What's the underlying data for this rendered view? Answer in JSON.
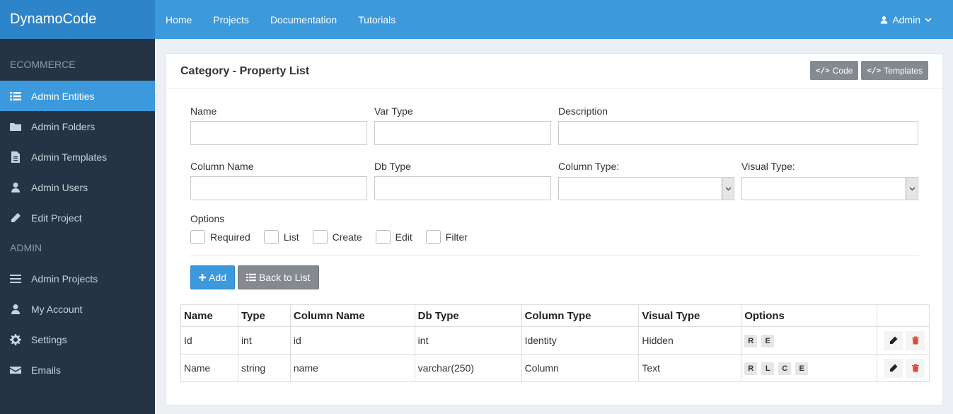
{
  "brand": "DynamoCode",
  "sidebar": {
    "section1": "ECOMMERCE",
    "items1": [
      {
        "label": "Admin Entities"
      },
      {
        "label": "Admin Folders"
      },
      {
        "label": "Admin Templates"
      },
      {
        "label": "Admin Users"
      },
      {
        "label": "Edit Project"
      }
    ],
    "section2": "ADMIN",
    "items2": [
      {
        "label": "Admin Projects"
      },
      {
        "label": "My Account"
      },
      {
        "label": "Settings"
      },
      {
        "label": "Emails"
      }
    ]
  },
  "topnav": {
    "links": [
      "Home",
      "Projects",
      "Documentation",
      "Tutorials"
    ],
    "user": "Admin"
  },
  "panel": {
    "title": "Category - Property List",
    "code_btn": "Code",
    "templates_btn": "Templates"
  },
  "form": {
    "name_label": "Name",
    "vartype_label": "Var Type",
    "description_label": "Description",
    "columnname_label": "Column Name",
    "dbtype_label": "Db Type",
    "columntype_label": "Column Type:",
    "visualtype_label": "Visual Type:",
    "options_label": "Options",
    "options": [
      "Required",
      "List",
      "Create",
      "Edit",
      "Filter"
    ],
    "add_btn": "Add",
    "back_btn": "Back to List"
  },
  "table": {
    "headers": [
      "Name",
      "Type",
      "Column Name",
      "Db Type",
      "Column Type",
      "Visual Type",
      "Options"
    ],
    "rows": [
      {
        "name": "Id",
        "type": "int",
        "column": "id",
        "db": "int",
        "coltype": "Identity",
        "visual": "Hidden",
        "opts": [
          "R",
          "E"
        ]
      },
      {
        "name": "Name",
        "type": "string",
        "column": "name",
        "db": "varchar(250)",
        "coltype": "Column",
        "visual": "Text",
        "opts": [
          "R",
          "L",
          "C",
          "E"
        ]
      }
    ]
  },
  "colors": {
    "brand_bg": "#2e84c8",
    "nav_bg": "#3c99dc",
    "sidebar_bg": "#243444",
    "delete_red": "#dd4b39"
  }
}
